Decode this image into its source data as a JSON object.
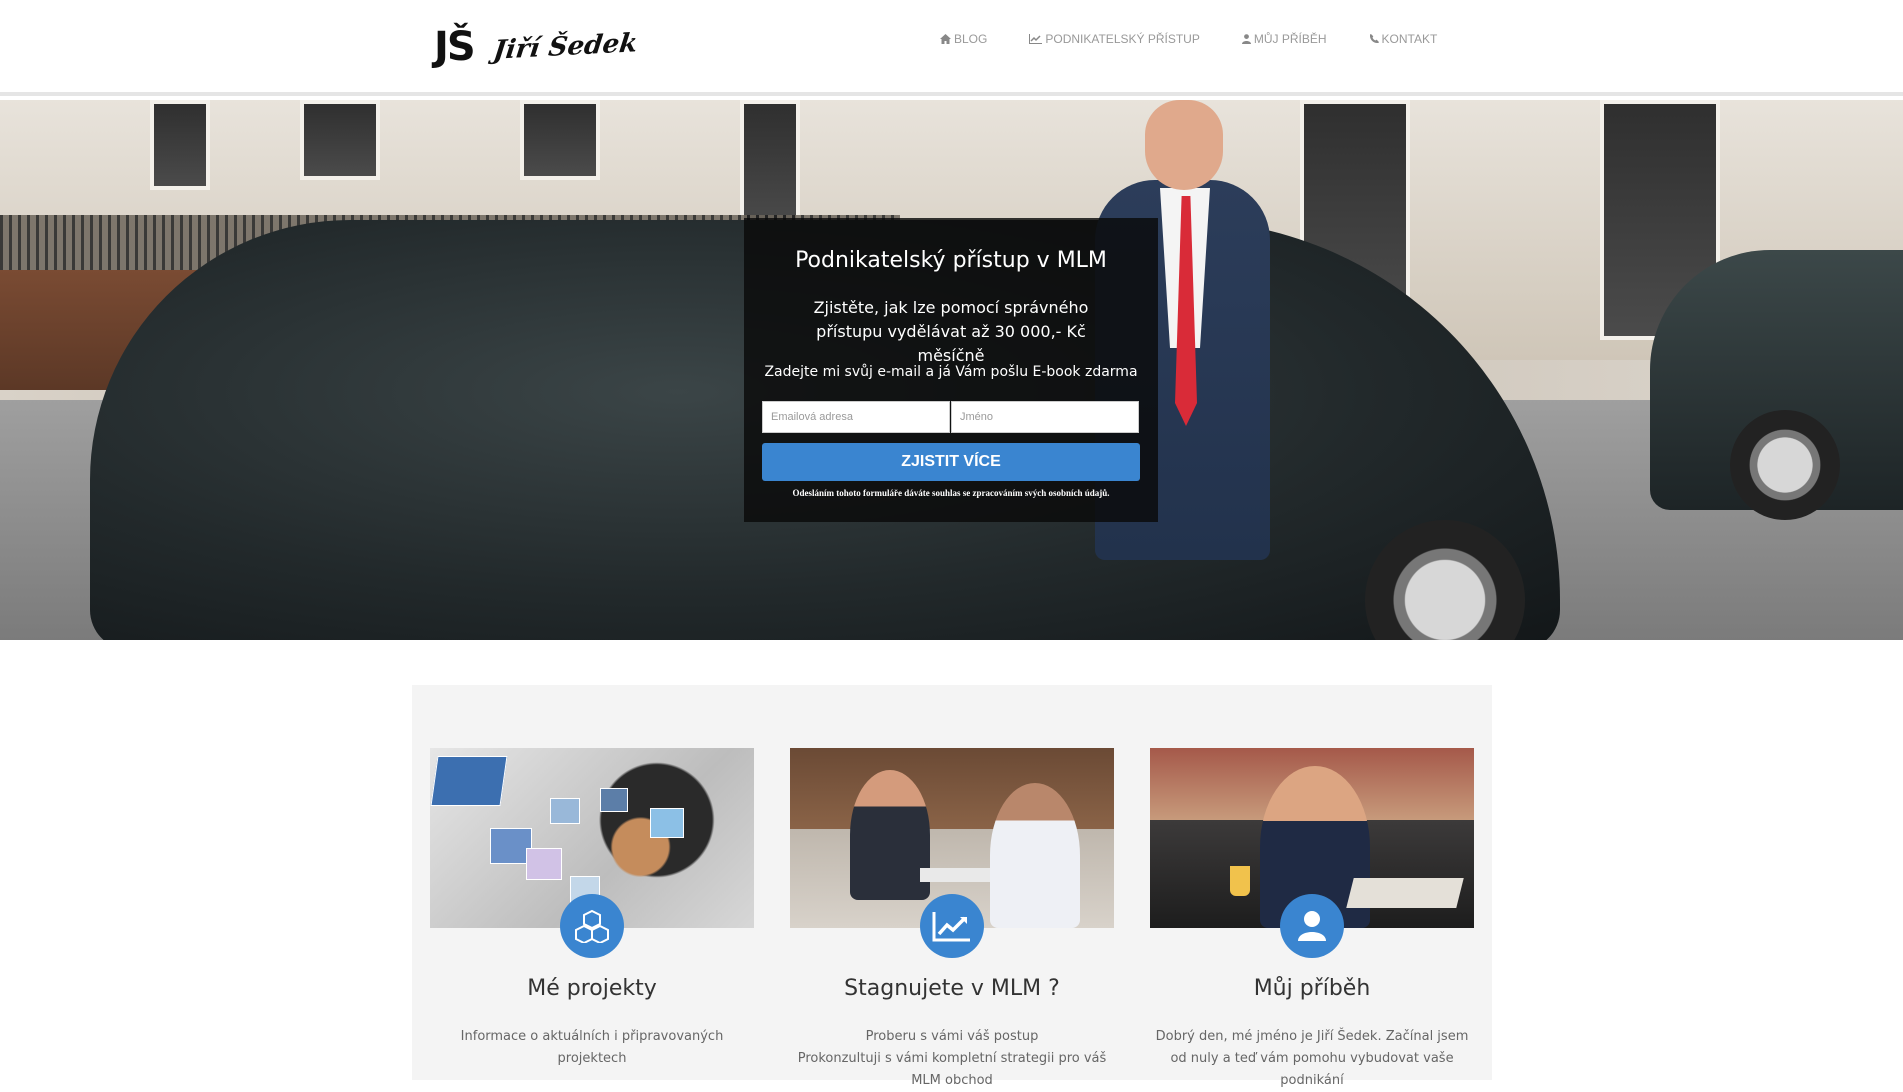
{
  "header": {
    "logo_monogram": "JŠ",
    "logo_signature": "Jiří Šedek",
    "nav": [
      {
        "label": "BLOG",
        "icon": "home-icon"
      },
      {
        "label": "PODNIKATELSKÝ PŘÍSTUP",
        "icon": "chart-icon"
      },
      {
        "label": "MŮJ PŘÍBĚH",
        "icon": "user-icon"
      },
      {
        "label": "KONTAKT",
        "icon": "phone-icon"
      }
    ]
  },
  "hero": {
    "title": "Podnikatelský přístup v MLM",
    "subtitle": "Zjistěte, jak lze pomocí správného přístupu vydělávat až 30 000,- Kč měsíčně",
    "note": "Zadejte mi svůj e-mail a já Vám pošlu E-book zdarma",
    "email_placeholder": "Emailová adresa",
    "name_placeholder": "Jméno",
    "submit_label": "ZJISTIT VÍCE",
    "consent": "Odesláním tohoto formuláře dáváte souhlas se zpracováním svých osobních údajů."
  },
  "features": [
    {
      "title": "Mé projekty",
      "description": "Informace o aktuálních i připravovaných projektech",
      "icon": "cubes-icon"
    },
    {
      "title": "Stagnujete v MLM ?",
      "description": "Proberu s vámi váš postup\nProkonzultuji s vámi kompletní strategii pro váš MLM obchod",
      "icon": "line-chart-icon"
    },
    {
      "title": "Můj příběh",
      "description": "Dobrý den, mé jméno je Jiří Šedek. Začínal jsem od nuly a teď vám pomohu vybudovat vaše podnikání",
      "icon": "user-icon"
    }
  ],
  "colors": {
    "accent": "#3a85d0",
    "nav_text": "#999999",
    "section_bg": "#f4f4f4"
  }
}
